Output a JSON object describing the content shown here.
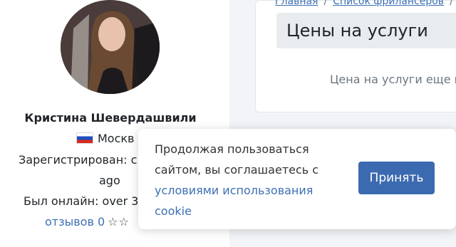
{
  "profile": {
    "name": "Кристина Шевердашвили",
    "location": "Москв",
    "registered": "Зарегистрирован: с",
    "registered_ago": "ago",
    "last_online": "Был онлайн: over 3",
    "reviews": "отзывов 0",
    "stars": "☆☆"
  },
  "breadcrumb": {
    "home": "Главная",
    "sep": "/",
    "freelancers": "Список фрилансеров",
    "sep2": "/"
  },
  "card": {
    "title": "Цены на услуги",
    "subtitle": "Цена на услуги еще н"
  },
  "cookie": {
    "text": "Продолжая пользоваться сайтом, вы соглашаетесь с",
    "link": "условиями использования cookie",
    "accept": "Принять"
  },
  "colors": {
    "accent": "#3c6ab0",
    "link": "#3c6fb4"
  }
}
